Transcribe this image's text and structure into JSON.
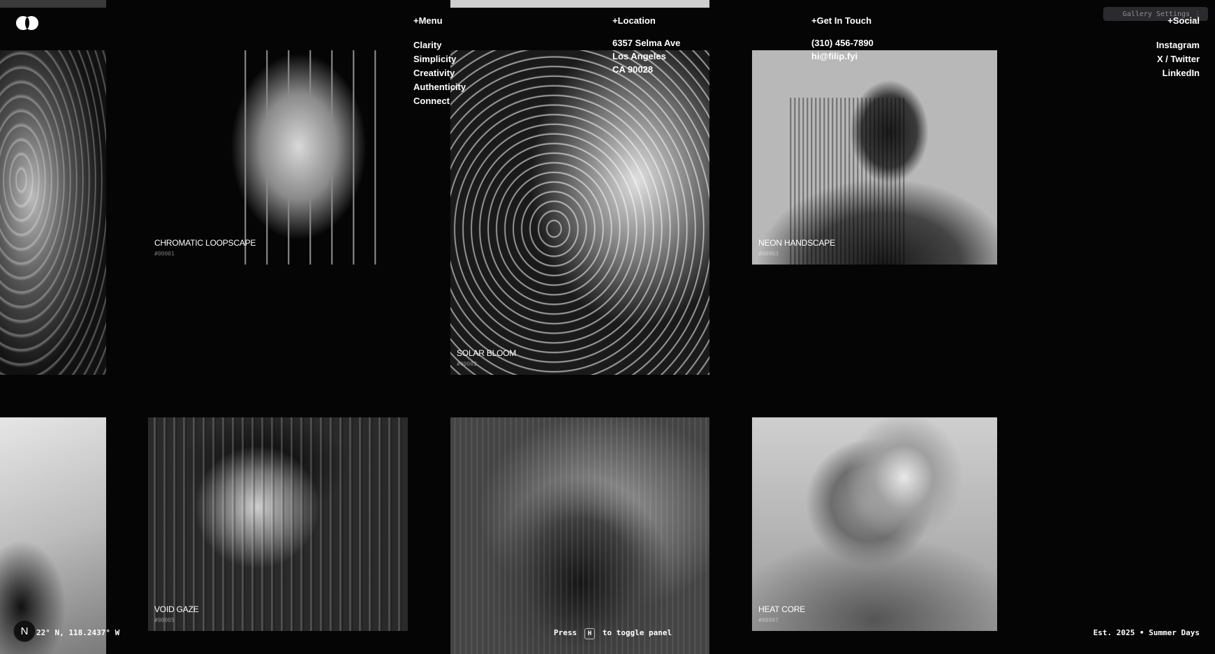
{
  "header": {
    "menu": {
      "heading": "+Menu",
      "items": [
        "Clarity",
        "Simplicity",
        "Creativity",
        "Authenticity",
        "Connect"
      ]
    },
    "location": {
      "heading": "+Location",
      "lines": [
        "6357 Selma Ave",
        "Los Angeles",
        "CA 90028"
      ]
    },
    "contact": {
      "heading": "+Get In Touch",
      "phone": "(310) 456-7890",
      "email": "hi@filip.fyi"
    },
    "social": {
      "heading": "+Social",
      "items": [
        "Instagram",
        "X / Twitter",
        "LinkedIn"
      ]
    },
    "settings_label": "Gallery Settings",
    "settings_icon": "drag-handle-icon"
  },
  "gallery": [
    {
      "title": "CHROMATIC LOOPSCAPE",
      "code": "#00001"
    },
    {
      "title": "SOLAR BLOOM",
      "code": "#00002"
    },
    {
      "title": "NEON HANDSCAPE",
      "code": "#00003"
    },
    {
      "title": "VOID GAZE",
      "code": "#00005"
    },
    {
      "title": "HEAT CORE",
      "code": "#00007"
    }
  ],
  "footer": {
    "coords": "22° N, 118.2437° W",
    "press": "Press",
    "key": "H",
    "toggle": "to toggle panel",
    "est": "Est. 2025 • Summer Days",
    "avatar_letter": "N"
  },
  "colors": {
    "background": "#050505",
    "text": "#ffffff",
    "settings_bg": "#2b2b2e"
  }
}
